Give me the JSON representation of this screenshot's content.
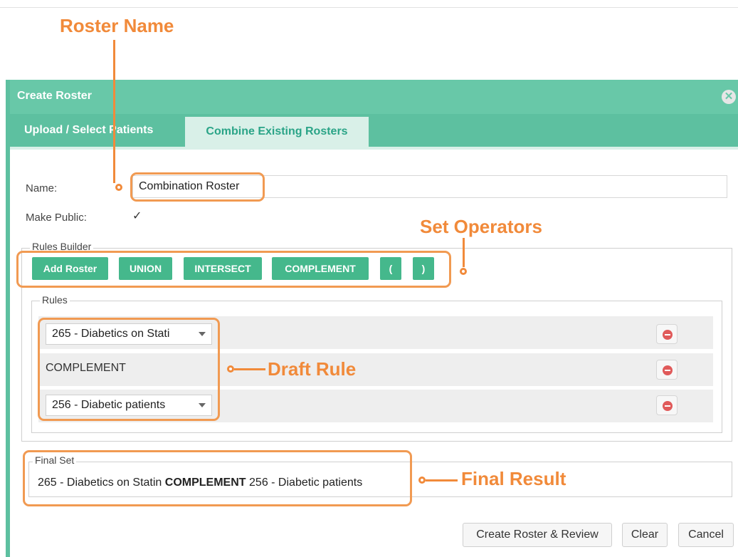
{
  "dialog": {
    "title": "Create Roster",
    "tabs": [
      {
        "label": "Upload / Select Patients",
        "active": false
      },
      {
        "label": "Combine Existing Rosters",
        "active": true
      }
    ]
  },
  "form": {
    "name_label": "Name:",
    "name_value": "Combination Roster",
    "public_label": "Make Public:",
    "public_checked": true
  },
  "rules_builder": {
    "legend": "Rules Builder",
    "buttons": [
      "Add Roster",
      "UNION",
      "INTERSECT",
      "COMPLEMENT",
      "(",
      ")"
    ],
    "rules_legend": "Rules",
    "rows": [
      {
        "type": "select",
        "value": "265 - Diabetics on Stati"
      },
      {
        "type": "operator",
        "value": "COMPLEMENT"
      },
      {
        "type": "select",
        "value": "256 - Diabetic patients"
      }
    ]
  },
  "final_set": {
    "legend": "Final Set",
    "left": "265 - Diabetics on Statin",
    "operator": "COMPLEMENT",
    "right": "256 - Diabetic patients"
  },
  "footer_buttons": {
    "create": "Create Roster & Review",
    "clear": "Clear",
    "cancel": "Cancel"
  },
  "annotations": {
    "roster_name": "Roster Name",
    "set_operators": "Set Operators",
    "draft_rule": "Draft Rule",
    "final_result": "Final Result"
  },
  "colors": {
    "accent": "#45b88c",
    "titlebar": "#68c8a8",
    "annotation": "#f18a3a"
  }
}
